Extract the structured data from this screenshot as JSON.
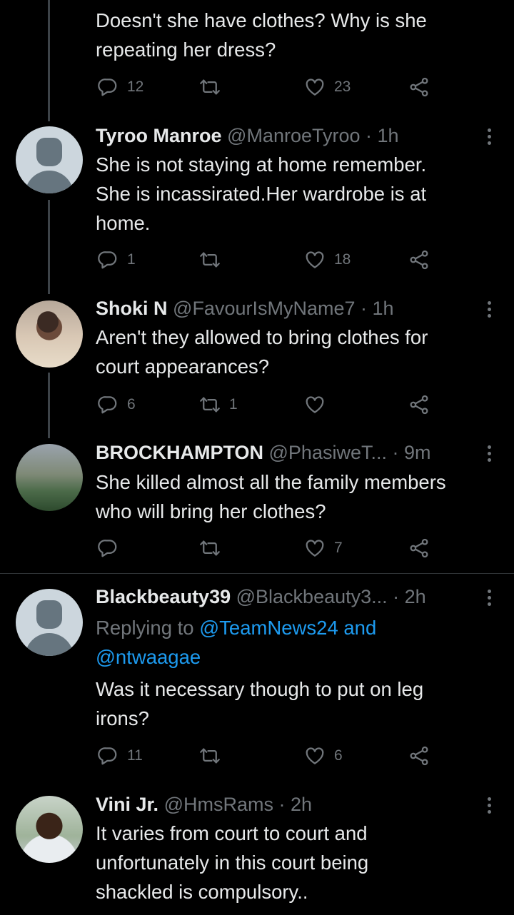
{
  "colors": {
    "background": "#000000",
    "text": "#e7e9ea",
    "muted": "#71767b",
    "link": "#1d9bf0",
    "divider": "#2f3336"
  },
  "tweets": [
    {
      "text_lines": [
        "Doesn't she have clothes? Why is she",
        "repeating her dress?"
      ],
      "replies": "12",
      "retweets": "",
      "likes": "23"
    },
    {
      "name": "Tyroo Manroe",
      "handle": "@ManroeTyroo",
      "time": "· 1h",
      "avatar": "default-avatar",
      "text_lines": [
        "She is not staying at home remember.",
        "She is incassirated.Her wardrobe is at",
        "home."
      ],
      "replies": "1",
      "retweets": "",
      "likes": "18"
    },
    {
      "name": "Shoki N",
      "handle": "@FavourIsMyName7",
      "time": "· 1h",
      "avatar": "photo",
      "text_lines": [
        "Aren't they allowed to bring clothes for",
        "court appearances?"
      ],
      "replies": "6",
      "retweets": "1",
      "likes": ""
    },
    {
      "name": "BROCKHAMPTON",
      "handle": "@PhasiweT...",
      "time": "· 9m",
      "avatar": "photo",
      "text_lines": [
        "She killed almost all the family members",
        "who will bring her clothes?"
      ],
      "replies": "",
      "retweets": "",
      "likes": "7"
    },
    {
      "name": "Blackbeauty39",
      "handle": "@Blackbeauty3...",
      "time": "· 2h",
      "avatar": "default-avatar",
      "replying_prefix": "Replying to ",
      "replying_link1": "@TeamNews24 and",
      "replying_link2": "@ntwaagae",
      "text_lines": [
        "Was it necessary though to put on leg",
        "irons?"
      ],
      "replies": "11",
      "retweets": "",
      "likes": "6"
    },
    {
      "name": "Vini Jr.",
      "handle": "@HmsRams",
      "time": "· 2h",
      "avatar": "photo",
      "text_lines": [
        "It varies from court to court and",
        "unfortunately in this court being",
        "shackled is compulsory.."
      ]
    }
  ]
}
